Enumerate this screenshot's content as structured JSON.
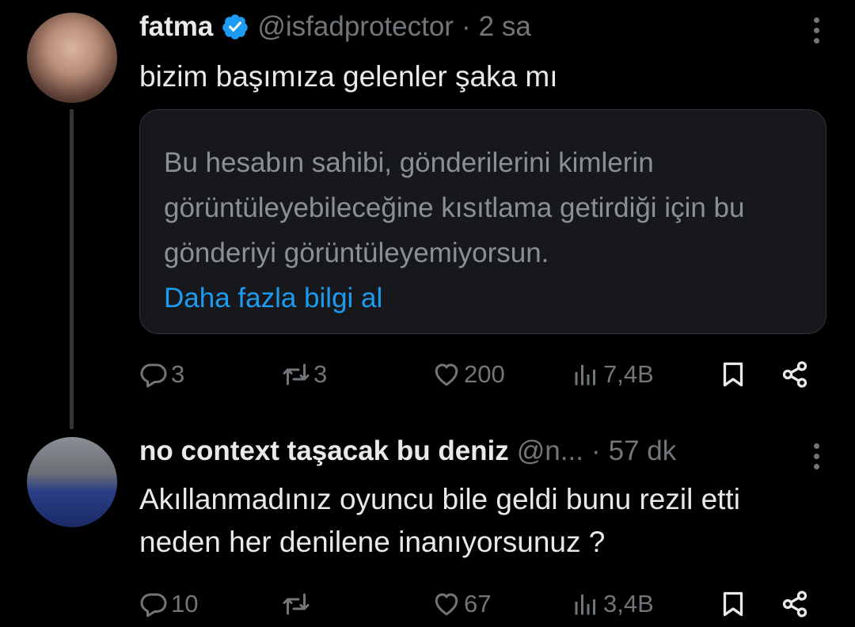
{
  "tweets": [
    {
      "name": "fatma",
      "handle": "@isfadprotector",
      "sep": "·",
      "time": "2 sa",
      "text": "bizim başımıza gelenler şaka mı",
      "quote": {
        "message": "Bu hesabın sahibi, gönderilerini kimlerin görüntüleyebileceğine kısıtlama getirdiği için bu gönderiyi görüntüleyemiyorsun.",
        "link": "Daha fazla bilgi al"
      },
      "replies": "3",
      "reposts": "3",
      "likes": "200",
      "views": "7,4B"
    },
    {
      "name": "no context taşacak bu deniz",
      "handle": "@n...",
      "sep": "·",
      "time": "57 dk",
      "text": "Akıllanmadınız oyuncu bile geldi bunu rezil etti neden her denilene inanıyorsunuz ?",
      "replies": "10",
      "reposts": "",
      "likes": "67",
      "views": "3,4B"
    }
  ],
  "colors": {
    "background": "#000000",
    "text": "#e7e9ea",
    "muted": "#71767b",
    "link": "#1d9bf0",
    "verified": "#1d9bf0"
  }
}
